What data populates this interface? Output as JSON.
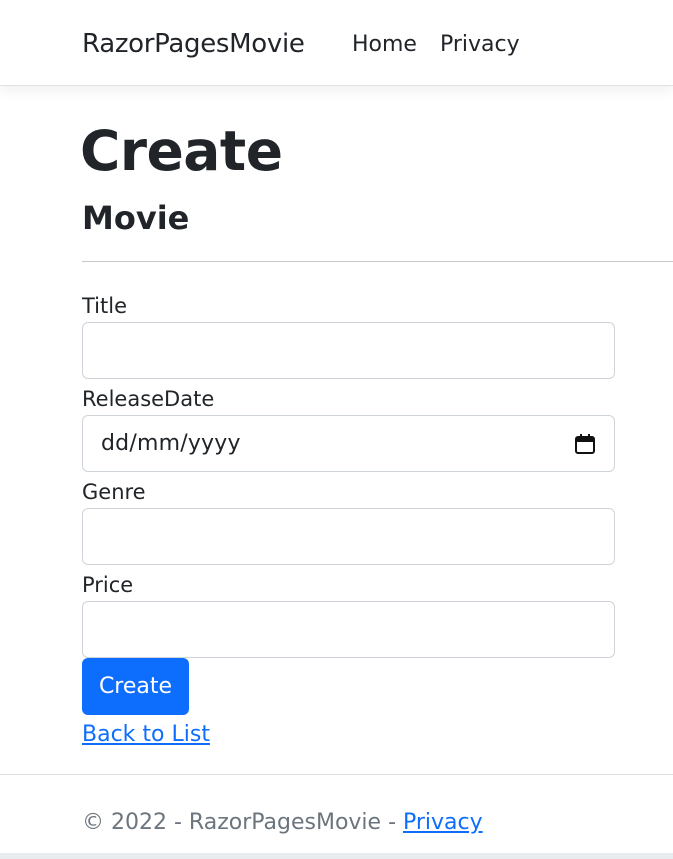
{
  "navbar": {
    "brand": "RazorPagesMovie",
    "links": [
      {
        "label": "Home"
      },
      {
        "label": "Privacy"
      }
    ]
  },
  "page": {
    "title": "Create",
    "subtitle": "Movie"
  },
  "form": {
    "fields": [
      {
        "label": "Title",
        "value": "",
        "placeholder": ""
      },
      {
        "label": "ReleaseDate",
        "value": "dd/mm/yyyy",
        "icon": "calendar-icon"
      },
      {
        "label": "Genre",
        "value": "",
        "placeholder": ""
      },
      {
        "label": "Price",
        "value": "",
        "placeholder": ""
      }
    ],
    "submit_label": "Create",
    "back_link": "Back to List"
  },
  "footer": {
    "text": "© 2022 - RazorPagesMovie - ",
    "link": "Privacy"
  },
  "colors": {
    "primary": "#0d6efd",
    "text": "#212529",
    "muted": "#6c757d",
    "border": "#ced4da"
  }
}
